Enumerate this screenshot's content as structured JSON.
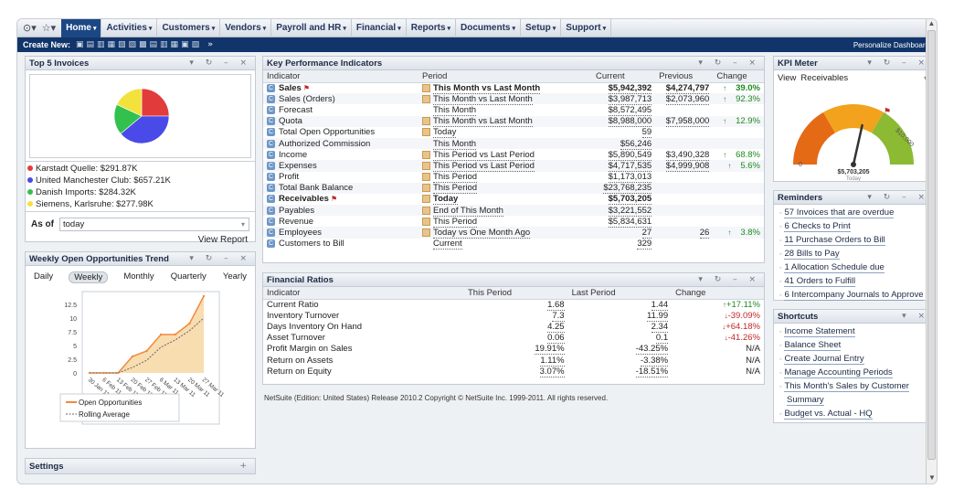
{
  "nav": {
    "items": [
      {
        "label": "Home",
        "active": true
      },
      {
        "label": "Activities"
      },
      {
        "label": "Customers"
      },
      {
        "label": "Vendors"
      },
      {
        "label": "Payroll and HR"
      },
      {
        "label": "Financial"
      },
      {
        "label": "Reports"
      },
      {
        "label": "Documents"
      },
      {
        "label": "Setup"
      },
      {
        "label": "Support"
      }
    ]
  },
  "createbar": {
    "label": "Create New:",
    "personalize": "Personalize Dashboard"
  },
  "top5": {
    "title": "Top 5 Invoices",
    "pie_colors": [
      "#e23b3b",
      "#4a4ae8",
      "#33c14d",
      "#f3e23c"
    ],
    "legend": [
      {
        "label": "Karstadt Quelle: $291.87K",
        "color": "#e23b3b"
      },
      {
        "label": "United Manchester Club: $657.21K",
        "color": "#4a4ae8"
      },
      {
        "label": "Danish Imports: $284.32K",
        "color": "#33c14d"
      },
      {
        "label": "Siemens, Karlsruhe: $277.98K",
        "color": "#f3e23c"
      }
    ],
    "asof_label": "As of",
    "asof_value": "today",
    "view_report": "View Report"
  },
  "trend": {
    "title": "Weekly Open Opportunities Trend",
    "tabs": [
      "Daily",
      "Weekly",
      "Monthly",
      "Quarterly",
      "Yearly"
    ],
    "legend": [
      "Open Opportunities",
      "Rolling Average"
    ]
  },
  "chart_data": {
    "type": "line",
    "x": [
      "30 Jan 11",
      "6 Feb 11",
      "13 Feb 11",
      "20 Feb 11",
      "27 Feb 11",
      "6 Mar 11",
      "13 Mar 11",
      "20 Mar 11",
      "27 Mar 11"
    ],
    "series": [
      {
        "name": "Open Opportunities",
        "values": [
          0,
          0,
          0,
          3,
          4,
          7,
          7,
          9,
          14
        ]
      },
      {
        "name": "Rolling Average",
        "values": [
          0,
          0,
          0,
          1,
          2.3,
          4.7,
          6,
          7.7,
          10
        ]
      }
    ],
    "yticks": [
      "0",
      "2.5",
      "5",
      "7.5",
      "10",
      "12.5"
    ],
    "ylim": [
      0,
      14
    ],
    "grid": false,
    "legend_placement": "bottom"
  },
  "settings": {
    "title": "Settings"
  },
  "kpi": {
    "title": "Key Performance Indicators",
    "headers": [
      "Indicator",
      "Period",
      "Current",
      "Previous",
      "Change"
    ],
    "rows": [
      {
        "indicator": "Sales",
        "period": "This Month vs Last Month",
        "current": "$5,942,392",
        "previous": "$4,274,797",
        "change": "39.0%",
        "bold": true,
        "flag": true
      },
      {
        "indicator": "Sales (Orders)",
        "period": "This Month vs Last Month",
        "current": "$3,987,713",
        "previous": "$2,073,960",
        "change": "92.3%"
      },
      {
        "indicator": "Forecast",
        "period": "This Month",
        "current": "$8,572,495",
        "previous": "",
        "change": ""
      },
      {
        "indicator": "Quota",
        "period": "This Month vs Last Month",
        "current": "$8,988,000",
        "previous": "$7,958,000",
        "change": "12.9%"
      },
      {
        "indicator": "Total Open Opportunities",
        "period": "Today",
        "current": "59",
        "previous": "",
        "change": ""
      },
      {
        "indicator": "Authorized Commission",
        "period": "This Month",
        "current": "$56,246",
        "previous": "",
        "change": ""
      },
      {
        "indicator": "Income",
        "period": "This Period vs Last Period",
        "current": "$5,890,549",
        "previous": "$3,490,328",
        "change": "68.8%"
      },
      {
        "indicator": "Expenses",
        "period": "This Period vs Last Period",
        "current": "$4,717,535",
        "previous": "$4,999,908",
        "change": "5.6%"
      },
      {
        "indicator": "Profit",
        "period": "This Period",
        "current": "$1,173,013",
        "previous": "",
        "change": ""
      },
      {
        "indicator": "Total Bank Balance",
        "period": "This Period",
        "current": "$23,768,235",
        "previous": "",
        "change": ""
      },
      {
        "indicator": "Receivables",
        "period": "Today",
        "current": "$5,703,205",
        "previous": "",
        "change": "",
        "bold": true,
        "flag": true
      },
      {
        "indicator": "Payables",
        "period": "End of This Month",
        "current": "$3,221,552",
        "previous": "",
        "change": ""
      },
      {
        "indicator": "Revenue",
        "period": "This Period",
        "current": "$5,834,631",
        "previous": "",
        "change": ""
      },
      {
        "indicator": "Employees",
        "period": "Today vs One Month Ago",
        "current": "27",
        "previous": "26",
        "change": "3.8%"
      },
      {
        "indicator": "Customers to Bill",
        "period": "Current",
        "current": "329",
        "previous": "",
        "change": ""
      }
    ]
  },
  "ratios": {
    "title": "Financial Ratios",
    "headers": [
      "Indicator",
      "This Period",
      "Last Period",
      "Change"
    ],
    "rows": [
      {
        "indicator": "Current Ratio",
        "this": "1.68",
        "last": "1.44",
        "change": "+17.11%",
        "dir": "up"
      },
      {
        "indicator": "Inventory Turnover",
        "this": "7.3",
        "last": "11.99",
        "change": "-39.09%",
        "dir": "down"
      },
      {
        "indicator": "Days Inventory On Hand",
        "this": "4.25",
        "last": "2.34",
        "change": "+64.18%",
        "dir": "down"
      },
      {
        "indicator": "Asset Turnover",
        "this": "0.06",
        "last": "0.1",
        "change": "-41.26%",
        "dir": "down"
      },
      {
        "indicator": "Profit Margin on Sales",
        "this": "19.91%",
        "last": "-43.25%",
        "change": "N/A",
        "dir": ""
      },
      {
        "indicator": "Return on Assets",
        "this": "1.11%",
        "last": "-3.38%",
        "change": "N/A",
        "dir": ""
      },
      {
        "indicator": "Return on Equity",
        "this": "3.07%",
        "last": "-18.51%",
        "change": "N/A",
        "dir": ""
      }
    ]
  },
  "footer": "NetSuite (Edition: United States) Release 2010.2 Copyright © NetSuite Inc. 1999-2011. All rights reserved.",
  "meter": {
    "title": "KPI Meter",
    "view_label": "View",
    "view_value": "Receivables",
    "value": "$5,703,205",
    "sub": "Today",
    "min_label": "0",
    "max_label": "$10,000",
    "level": 0.57
  },
  "reminders": {
    "title": "Reminders",
    "items": [
      "57 Invoices that are overdue",
      "6 Checks to Print",
      "11 Purchase Orders to Bill",
      "28 Bills to Pay",
      "1 Allocation Schedule due",
      "41 Orders to Fulfill",
      "6 Intercompany Journals to Approve"
    ]
  },
  "shortcuts": {
    "title": "Shortcuts",
    "items": [
      "Income Statement",
      "Balance Sheet",
      "Create Journal Entry",
      "Manage Accounting Periods",
      "This Month's Sales by Customer",
      "Summary",
      "Budget vs. Actual - HQ"
    ]
  }
}
